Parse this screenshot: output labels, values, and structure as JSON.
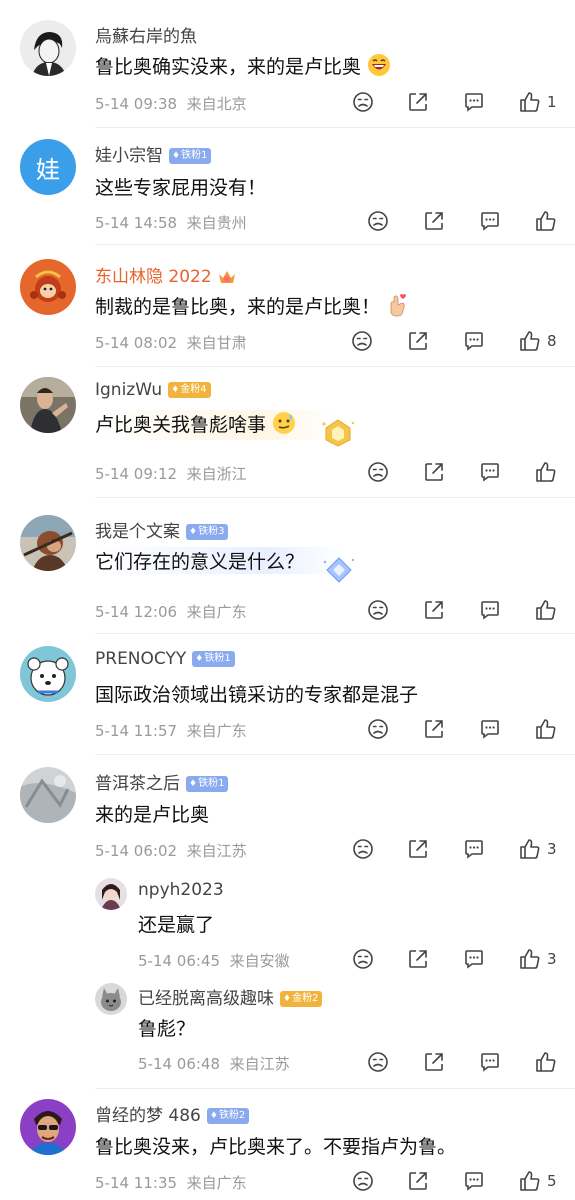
{
  "comments": [
    {
      "user": "烏蘇右岸的魚",
      "text": "鲁比奥确实没来，来的是卢比奥",
      "date": "5-14 09:38",
      "loc": "来自北京",
      "likes": "1"
    },
    {
      "user": "娃小宗智",
      "badge": "铁粉1",
      "text": "这些专家屁用没有！",
      "date": "5-14 14:58",
      "loc": "来自贵州",
      "likes": ""
    },
    {
      "user": "东山林隐 2022",
      "text": "制裁的是鲁比奥，来的是卢比奥！",
      "date": "5-14 08:02",
      "loc": "来自甘肃",
      "likes": "8"
    },
    {
      "user": "IgnizWu",
      "badge": "金粉4",
      "text": "卢比奥关我鲁彪啥事",
      "date": "5-14 09:12",
      "loc": "来自浙江",
      "likes": ""
    },
    {
      "user": "我是个文案",
      "badge": "铁粉3",
      "text": "它们存在的意义是什么？",
      "date": "5-14 12:06",
      "loc": "来自广东",
      "likes": ""
    },
    {
      "user": "PRENOCYY",
      "badge": "铁粉1",
      "text": "国际政治领域出镜采访的专家都是混子",
      "date": "5-14 11:57",
      "loc": "来自广东",
      "likes": ""
    },
    {
      "user": "普洱茶之后",
      "badge": "铁粉1",
      "text": "来的是卢比奥",
      "date": "5-14 06:02",
      "loc": "来自江苏",
      "likes": "3"
    },
    {
      "user": "曾经的梦 486",
      "badge": "铁粉2",
      "text": "鲁比奥没来，卢比奥来了。不要指卢为鲁。",
      "date": "5-14 11:35",
      "loc": "来自广东",
      "likes": "5"
    }
  ],
  "replies": [
    {
      "user": "npyh2023",
      "text": "还是赢了",
      "date": "5-14 06:45",
      "loc": "来自安徽",
      "likes": "3"
    },
    {
      "user": "已经脱离高级趣味",
      "badge": "金粉2",
      "text": "鲁彪？",
      "date": "5-14 06:48",
      "loc": "来自江苏",
      "likes": ""
    }
  ],
  "avatar_text": {
    "c1": "娃"
  },
  "icons": [
    "dislike-icon",
    "share-icon",
    "comment-icon",
    "like-icon"
  ],
  "colors": {
    "iron_badge": "#8aaaf0",
    "gold_badge": "#f2b33d",
    "orange_name": "#e8632b"
  }
}
